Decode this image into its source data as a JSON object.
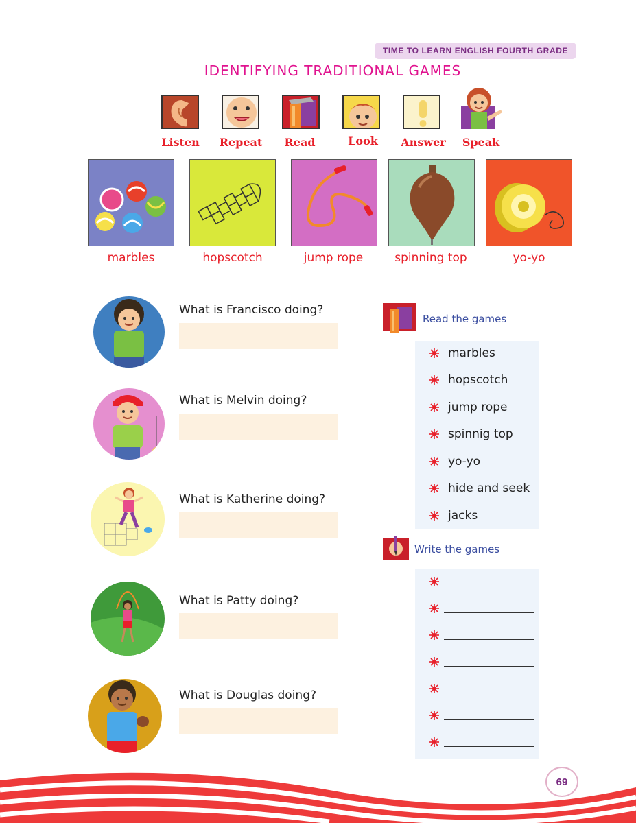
{
  "header": {
    "banner_text": "TIME TO LEARN ENGLISH FOURTH GRADE",
    "title": "IDENTIFYING TRADITIONAL GAMES"
  },
  "instruction_icons": [
    {
      "label": "Listen",
      "icon": "ear-icon"
    },
    {
      "label": "Repeat",
      "icon": "mouth-face-icon"
    },
    {
      "label": "Read",
      "icon": "book-icon"
    },
    {
      "label": "Look",
      "icon": "looking-face-icon"
    },
    {
      "label": "Answer",
      "icon": "exclamation-icon"
    },
    {
      "label": "Speak",
      "icon": "speaking-girl-icon"
    }
  ],
  "games": [
    {
      "label": "marbles",
      "color": "#7b82c6"
    },
    {
      "label": "hopscotch",
      "color": "#d9e83a"
    },
    {
      "label": "jump rope",
      "color": "#d36ec4"
    },
    {
      "label": "spinning top",
      "color": "#a9dcbc"
    },
    {
      "label": "yo-yo",
      "color": "#f0542a"
    }
  ],
  "questions": [
    {
      "text": "What is Francisco doing?",
      "answer": ""
    },
    {
      "text": "What is Melvin doing?",
      "answer": ""
    },
    {
      "text": "What is Katherine doing?",
      "answer": ""
    },
    {
      "text": "What is Patty doing?",
      "answer": ""
    },
    {
      "text": "What is Douglas doing?",
      "answer": ""
    }
  ],
  "read_section": {
    "title": "Read the games",
    "items": [
      "marbles",
      "hopscotch",
      "jump rope",
      "spinnig top",
      "yo-yo",
      "hide and seek",
      "jacks"
    ]
  },
  "write_section": {
    "title": "Write the games",
    "blank_count": 7
  },
  "page_number": "69",
  "colors": {
    "accent_pink": "#e0138f",
    "label_red": "#e8202a",
    "banner_purple": "#7a2c82",
    "section_blue": "#3b4ea0"
  }
}
